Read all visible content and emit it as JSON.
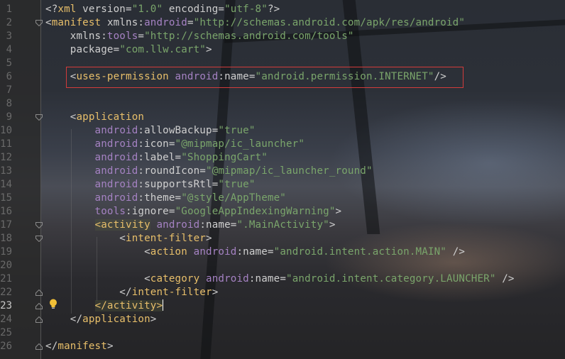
{
  "editor": {
    "lines": [
      {
        "n": "1",
        "tokens": [
          [
            "t-plain",
            "<?"
          ],
          [
            "t-tag",
            "xml"
          ],
          [
            "t-plain",
            " version="
          ],
          [
            "t-str",
            "\"1.0\""
          ],
          [
            "t-plain",
            " encoding="
          ],
          [
            "t-str",
            "\"utf-8\""
          ],
          [
            "t-plain",
            "?>"
          ]
        ]
      },
      {
        "n": "2",
        "tokens": [
          [
            "t-plain",
            "<"
          ],
          [
            "t-tag",
            "manifest"
          ],
          [
            "t-plain",
            " xmlns:"
          ],
          [
            "t-pre",
            "android"
          ],
          [
            "t-plain",
            "="
          ],
          [
            "t-str",
            "\"http://schemas.android.com/apk/res/android\""
          ]
        ]
      },
      {
        "n": "3",
        "tokens": [
          [
            "t-plain",
            "    xmlns:"
          ],
          [
            "t-pre",
            "tools"
          ],
          [
            "t-plain",
            "="
          ],
          [
            "t-str",
            "\"http://schemas.android.com/tools\""
          ]
        ]
      },
      {
        "n": "4",
        "tokens": [
          [
            "t-plain",
            "    package="
          ],
          [
            "t-str",
            "\"com.llw.cart\""
          ],
          [
            "t-plain",
            ">"
          ]
        ]
      },
      {
        "n": "5",
        "tokens": []
      },
      {
        "n": "6",
        "tokens": [
          [
            "t-plain",
            "    <"
          ],
          [
            "t-tag",
            "uses-permission"
          ],
          [
            "t-plain",
            " "
          ],
          [
            "t-pre",
            "android"
          ],
          [
            "t-plain",
            ":name="
          ],
          [
            "t-str",
            "\"android.permission.INTERNET\""
          ],
          [
            "t-plain",
            "/>"
          ]
        ]
      },
      {
        "n": "7",
        "tokens": []
      },
      {
        "n": "8",
        "tokens": []
      },
      {
        "n": "9",
        "tokens": [
          [
            "t-plain",
            "    <"
          ],
          [
            "t-tag",
            "application"
          ]
        ]
      },
      {
        "n": "10",
        "tokens": [
          [
            "t-plain",
            "        "
          ],
          [
            "t-pre",
            "android"
          ],
          [
            "t-plain",
            ":allowBackup="
          ],
          [
            "t-str",
            "\"true\""
          ]
        ]
      },
      {
        "n": "11",
        "tokens": [
          [
            "t-plain",
            "        "
          ],
          [
            "t-pre",
            "android"
          ],
          [
            "t-plain",
            ":icon="
          ],
          [
            "t-str",
            "\"@mipmap/ic_launcher\""
          ]
        ]
      },
      {
        "n": "12",
        "tokens": [
          [
            "t-plain",
            "        "
          ],
          [
            "t-pre",
            "android"
          ],
          [
            "t-plain",
            ":label="
          ],
          [
            "t-str",
            "\"ShoppingCart\""
          ]
        ]
      },
      {
        "n": "13",
        "tokens": [
          [
            "t-plain",
            "        "
          ],
          [
            "t-pre",
            "android"
          ],
          [
            "t-plain",
            ":roundIcon="
          ],
          [
            "t-str",
            "\"@mipmap/ic_launcher_round\""
          ]
        ]
      },
      {
        "n": "14",
        "tokens": [
          [
            "t-plain",
            "        "
          ],
          [
            "t-pre",
            "android"
          ],
          [
            "t-plain",
            ":supportsRtl="
          ],
          [
            "t-str",
            "\"true\""
          ]
        ]
      },
      {
        "n": "15",
        "tokens": [
          [
            "t-plain",
            "        "
          ],
          [
            "t-pre",
            "android"
          ],
          [
            "t-plain",
            ":theme="
          ],
          [
            "t-str",
            "\"@style/AppTheme\""
          ]
        ]
      },
      {
        "n": "16",
        "tokens": [
          [
            "t-plain",
            "        "
          ],
          [
            "t-pre",
            "tools"
          ],
          [
            "t-plain",
            ":ignore="
          ],
          [
            "t-str",
            "\"GoogleAppIndexingWarning\""
          ],
          [
            "t-plain",
            ">"
          ]
        ]
      },
      {
        "n": "17",
        "tokens": [
          [
            "t-plain",
            "        "
          ],
          [
            "hl-tag",
            "<activity"
          ],
          [
            "t-plain",
            " "
          ],
          [
            "t-pre",
            "android"
          ],
          [
            "t-plain",
            ":name="
          ],
          [
            "t-str",
            "\".MainActivity\""
          ],
          [
            "t-plain",
            ">"
          ]
        ]
      },
      {
        "n": "18",
        "tokens": [
          [
            "t-plain",
            "            <"
          ],
          [
            "t-tag",
            "intent-filter"
          ],
          [
            "t-plain",
            ">"
          ]
        ]
      },
      {
        "n": "19",
        "tokens": [
          [
            "t-plain",
            "                <"
          ],
          [
            "t-tag",
            "action"
          ],
          [
            "t-plain",
            " "
          ],
          [
            "t-pre",
            "android"
          ],
          [
            "t-plain",
            ":name="
          ],
          [
            "t-str",
            "\"android.intent.action.MAIN\""
          ],
          [
            "t-plain",
            " />"
          ]
        ]
      },
      {
        "n": "20",
        "tokens": []
      },
      {
        "n": "21",
        "tokens": [
          [
            "t-plain",
            "                <"
          ],
          [
            "t-tag",
            "category"
          ],
          [
            "t-plain",
            " "
          ],
          [
            "t-pre",
            "android"
          ],
          [
            "t-plain",
            ":name="
          ],
          [
            "t-str",
            "\"android.intent.category.LAUNCHER\""
          ],
          [
            "t-plain",
            " />"
          ]
        ]
      },
      {
        "n": "22",
        "tokens": [
          [
            "t-plain",
            "            </"
          ],
          [
            "t-tag",
            "intent-filter"
          ],
          [
            "t-plain",
            ">"
          ]
        ]
      },
      {
        "n": "23",
        "tokens": [
          [
            "t-plain",
            "        "
          ],
          [
            "hl-tag",
            "</activity>"
          ]
        ]
      },
      {
        "n": "24",
        "tokens": [
          [
            "t-plain",
            "    </"
          ],
          [
            "t-tag",
            "application"
          ],
          [
            "t-plain",
            ">"
          ]
        ]
      },
      {
        "n": "25",
        "tokens": []
      },
      {
        "n": "26",
        "tokens": [
          [
            "t-plain",
            "</"
          ],
          [
            "t-tag",
            "manifest"
          ],
          [
            "t-plain",
            ">"
          ]
        ]
      }
    ],
    "current_line": "23",
    "highlighted_line": "6"
  },
  "colors": {
    "tag": "#e8bf6a",
    "namespace": "#a582c3",
    "string": "#7aa56b",
    "plain": "#cfcfcf",
    "highlight_box": "#d23b3b",
    "bulb": "#f2c037"
  },
  "icons": {
    "gutter_hint": "lightbulb-icon",
    "fold": "fold-icon"
  }
}
